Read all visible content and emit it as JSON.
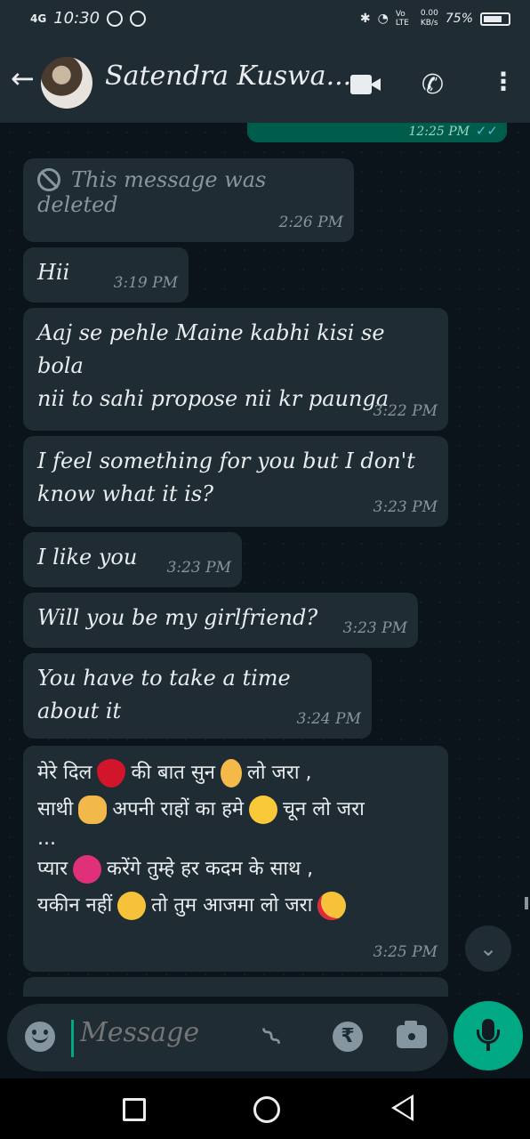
{
  "status_bar": {
    "network": "4G",
    "time": "10:30",
    "speed_value": "0.00",
    "speed_unit": "KB/s",
    "volte": "Vo LTE",
    "battery": "75%",
    "battery_level": 0.75
  },
  "header": {
    "contact_name": "Satendra Kuswa..."
  },
  "top_partial_message": {
    "time": "12:25 PM"
  },
  "messages": [
    {
      "text": "This message was deleted",
      "time": "2:26 PM",
      "deleted": true
    },
    {
      "text": "Hii",
      "time": "3:19 PM"
    },
    {
      "text": "Aaj se pehle Maine kabhi kisi se bola\nnii to sahi propose nii kr paunga",
      "time": "3:22 PM"
    },
    {
      "text": "I feel something for you but I don't\nknow what it is?",
      "time": "3:23 PM"
    },
    {
      "text": "I like you",
      "time": "3:23 PM"
    },
    {
      "text": "Will you be my girlfriend?",
      "time": "3:23 PM"
    },
    {
      "text": "You have to take a time about it",
      "time": "3:24 PM"
    },
    {
      "lines": [
        "मेरे दिल",
        "की बात सुन",
        "लो जरा ,",
        "साथी",
        "अपनी राहों का हमे",
        "चून लो जरा",
        "...",
        "प्यार",
        "करेंगे तुम्हे हर कदम के साथ ,",
        "यकीन नहीं",
        "तो तुम आजमा लो जरा"
      ],
      "emojis": [
        "red-heart",
        "ear",
        "handshake",
        "smiling-face",
        "heart-with-arrow",
        "raised-eyebrow-face",
        "heart-eyes-face"
      ],
      "time": "3:25 PM"
    }
  ],
  "composer": {
    "placeholder": "Message"
  }
}
